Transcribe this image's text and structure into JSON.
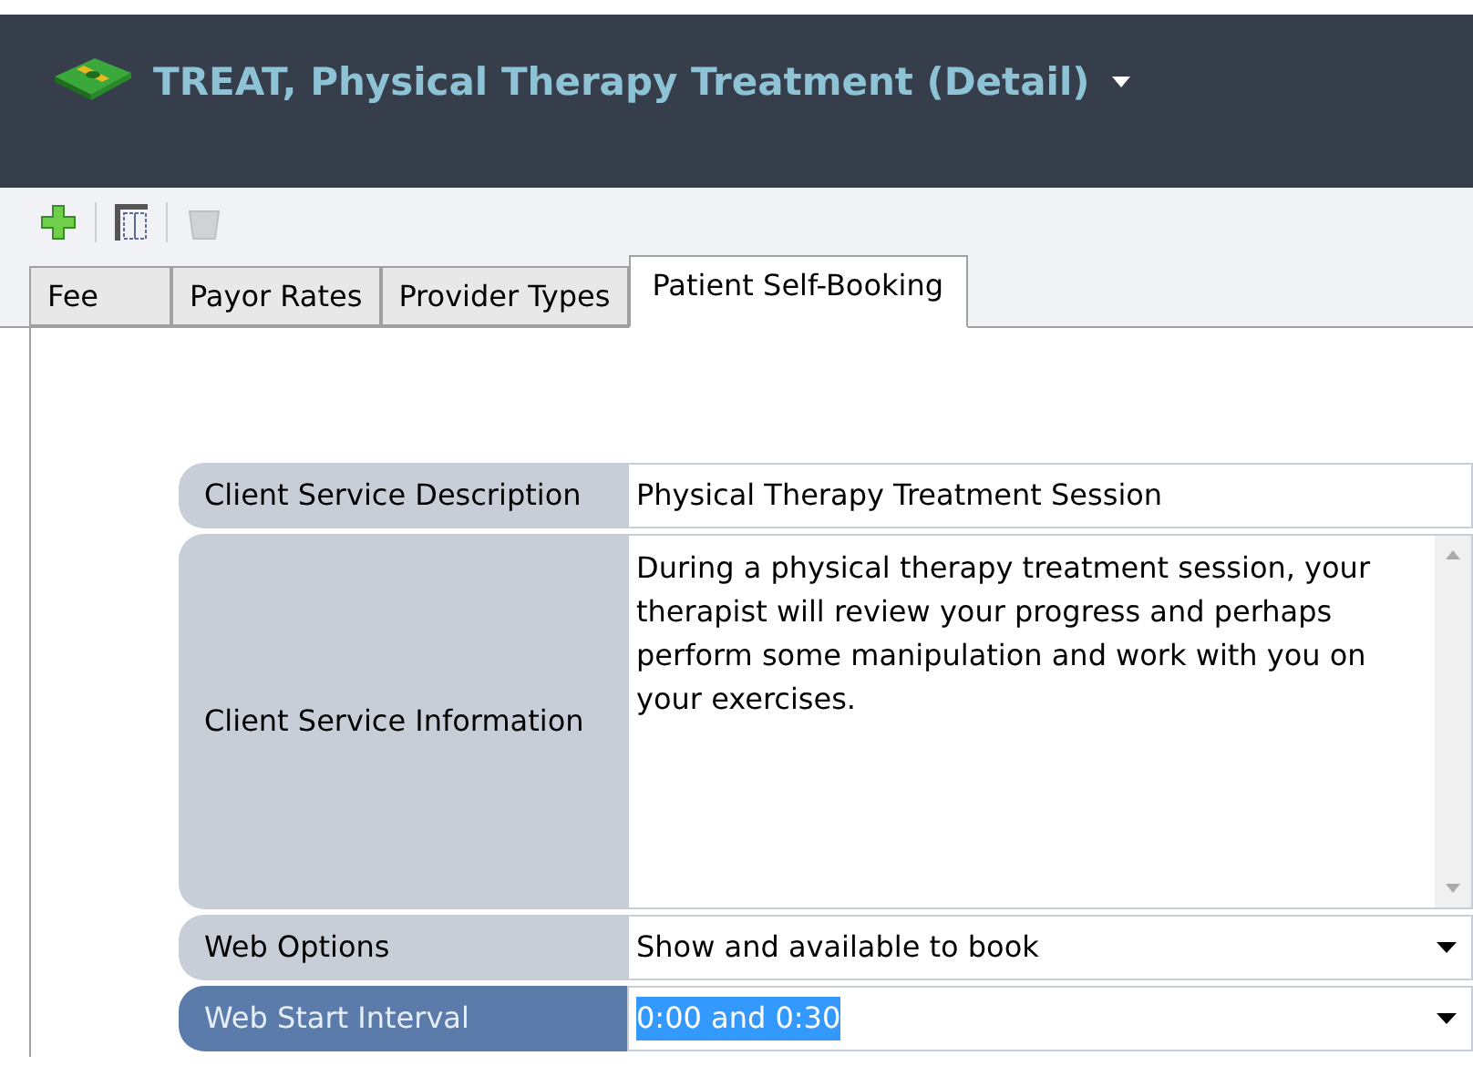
{
  "window": {
    "title": "TREAT, Physical Therapy Treatment (Detail)"
  },
  "toolbar": [
    {
      "kind": "add",
      "disabled": false
    },
    {
      "kind": "columns",
      "disabled": false
    },
    {
      "kind": "delete",
      "disabled": true
    }
  ],
  "tabs": [
    {
      "label": "Fee",
      "selected": false
    },
    {
      "label": "Payor Rates",
      "selected": false
    },
    {
      "label": "Provider Types",
      "selected": false
    },
    {
      "label": "Patient Self-Booking",
      "selected": true
    }
  ],
  "fields": [
    {
      "kind": "text",
      "label": "Client Service Description",
      "value": "Physical Therapy Treatment Session",
      "focused": false
    },
    {
      "kind": "textarea",
      "label": "Client Service Information",
      "value": "During a physical therapy treatment session, your therapist will review your progress and perhaps perform some manipulation and work with you on your exercises.",
      "focused": false
    },
    {
      "kind": "dropdown",
      "label": "Web Options",
      "value": "Show and available to book",
      "focused": false
    },
    {
      "kind": "dropdown",
      "label": "Web Start Interval",
      "value": "0:00 and 0:30",
      "focused": true
    }
  ]
}
